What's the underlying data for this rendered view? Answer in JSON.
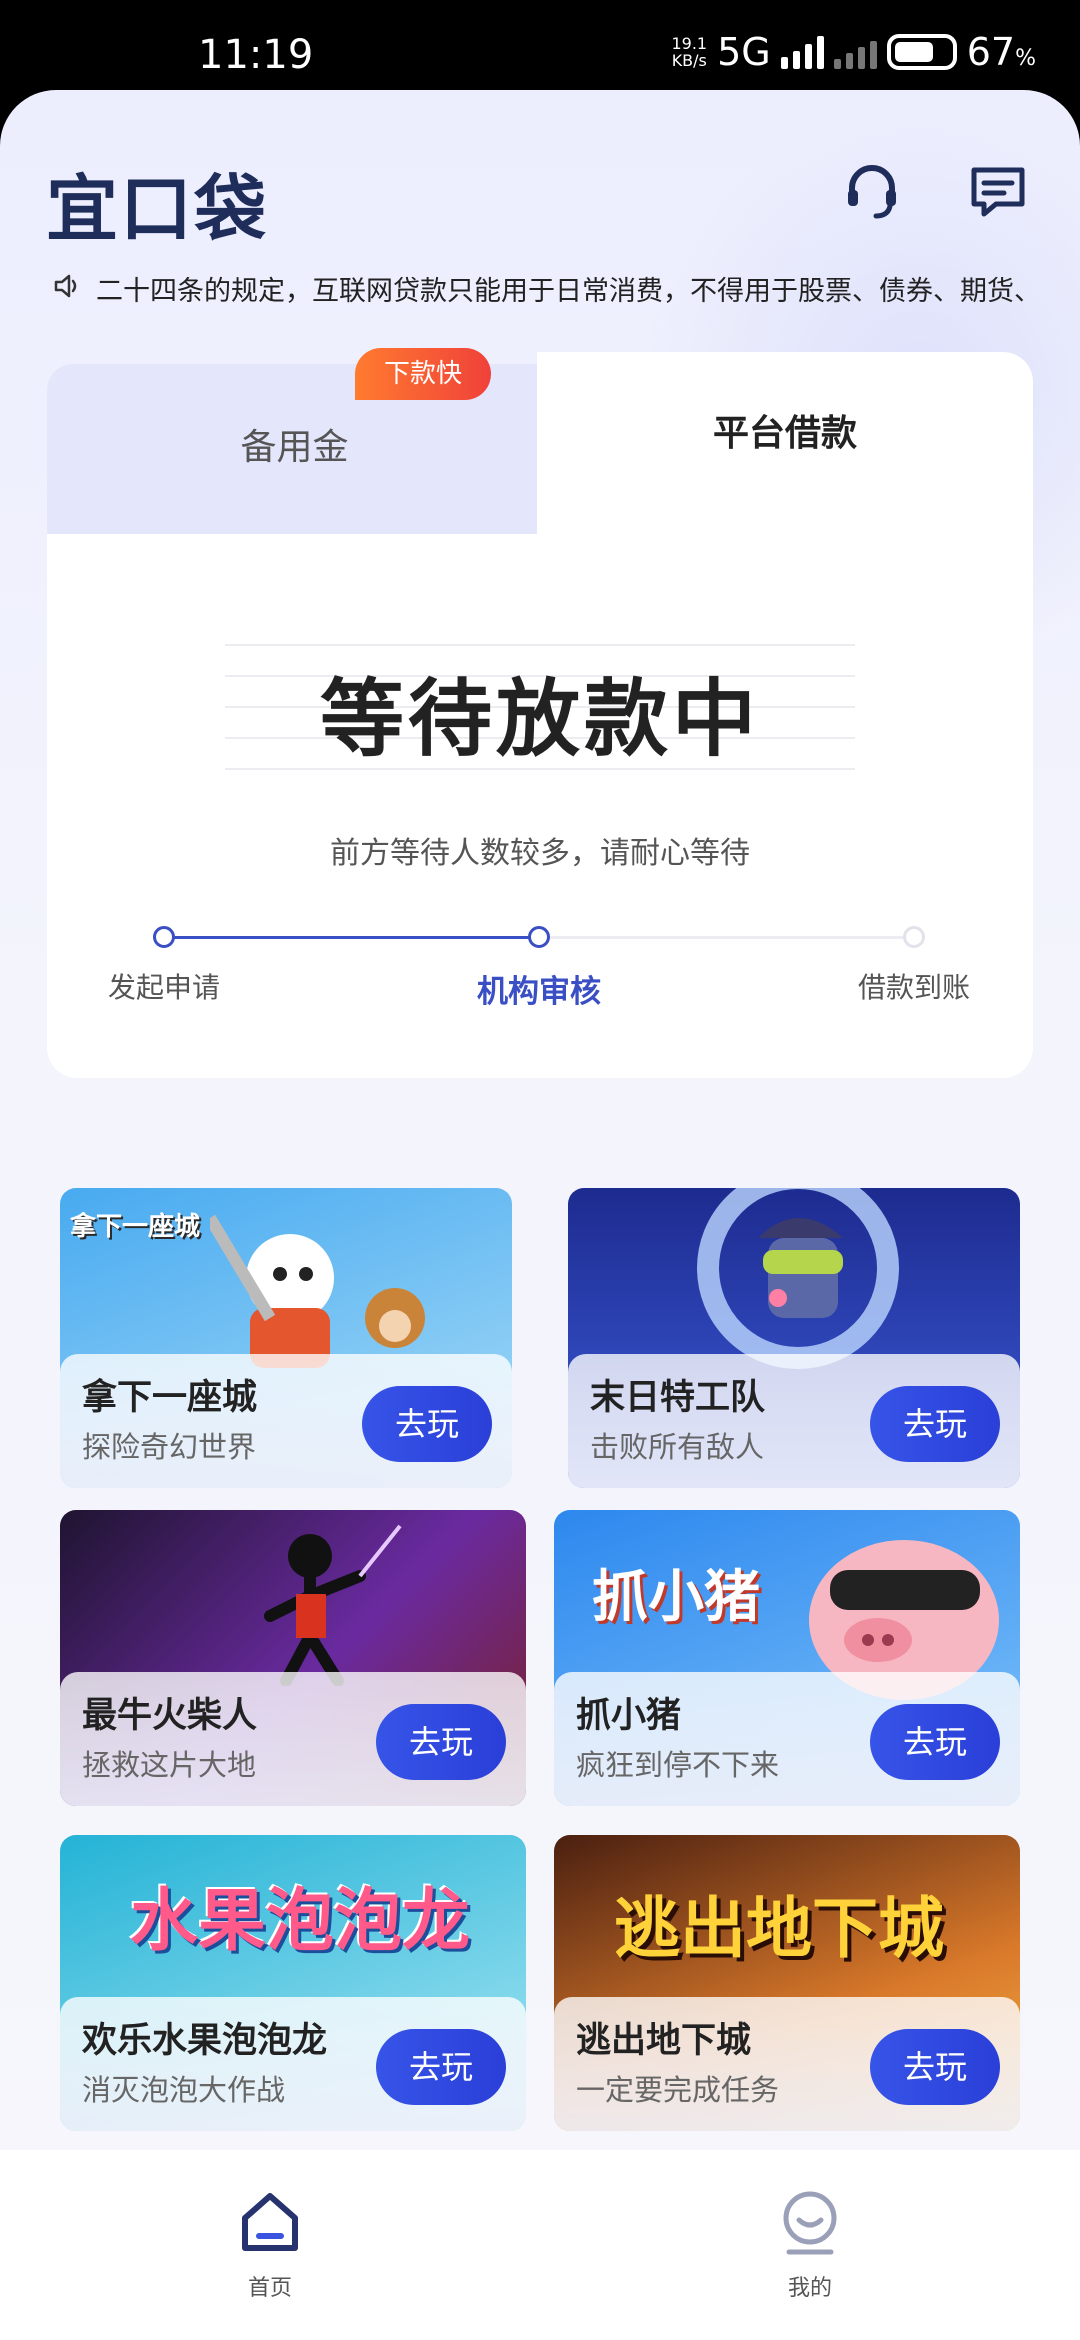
{
  "status_bar": {
    "time": "11:19",
    "net_speed_value": "19.1",
    "net_speed_unit": "KB/s",
    "network": "5G",
    "battery_percent": "67",
    "battery_unit": "%"
  },
  "header": {
    "logo": "宜口袋",
    "support_icon": "headset-icon",
    "message_icon": "message-icon"
  },
  "notice": {
    "icon": "speaker-icon",
    "text": "二十四条的规定，互联网贷款只能用于日常消费，不得用于股票、债券、期货、"
  },
  "loan_card": {
    "tabs": [
      {
        "label": "备用金",
        "badge": "下款快"
      },
      {
        "label": "平台借款"
      }
    ],
    "status_title": "等待放款中",
    "status_subtitle": "前方等待人数较多，请耐心等待",
    "steps": [
      {
        "label": "发起申请"
      },
      {
        "label": "机构审核"
      },
      {
        "label": "借款到账"
      }
    ]
  },
  "games": [
    {
      "title": "拿下一座城",
      "desc": "探险奇幻世界",
      "play": "去玩",
      "art_text": "拿下一座城",
      "colors": [
        "#3ba3ee",
        "#8fd0f5"
      ]
    },
    {
      "title": "末日特工队",
      "desc": "击败所有敌人",
      "play": "去玩",
      "art_text": "",
      "colors": [
        "#1c2a8c",
        "#3e62e6"
      ]
    },
    {
      "title": "最牛火柴人",
      "desc": "拯救这片大地",
      "play": "去玩",
      "art_text": "",
      "colors": [
        "#2a1740",
        "#8a2ec4"
      ]
    },
    {
      "title": "抓小猪",
      "desc": "疯狂到停不下来",
      "play": "去玩",
      "art_text": "抓小猪",
      "colors": [
        "#3a8ff0",
        "#7cc0fa"
      ]
    },
    {
      "title": "欢乐水果泡泡龙",
      "desc": "消灭泡泡大作战",
      "play": "去玩",
      "art_text": "水果泡泡龙",
      "colors": [
        "#2ab9d8",
        "#9be4f2"
      ]
    },
    {
      "title": "逃出地下城",
      "desc": "一定要完成任务",
      "play": "去玩",
      "art_text": "逃出地下城",
      "colors": [
        "#5a2410",
        "#e2832a"
      ]
    }
  ],
  "bottom_nav": [
    {
      "label": "首页",
      "icon": "home-icon"
    },
    {
      "label": "我的",
      "icon": "profile-icon"
    }
  ]
}
